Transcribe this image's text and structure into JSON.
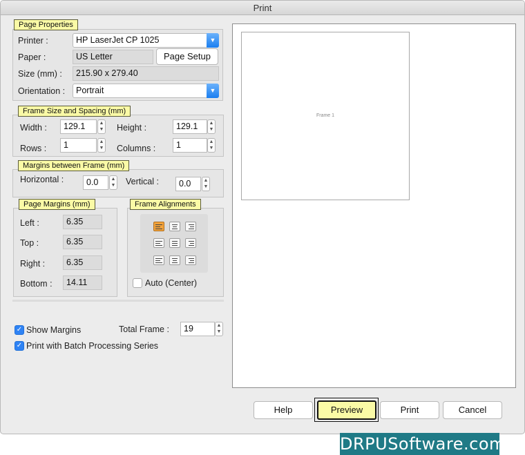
{
  "window": {
    "title": "Print"
  },
  "page_properties": {
    "legend": "Page Properties",
    "printer_label": "Printer :",
    "printer_value": "HP LaserJet CP 1025",
    "paper_label": "Paper :",
    "paper_value": "US Letter",
    "page_setup_button": "Page Setup",
    "size_label": "Size (mm) :",
    "size_value": "215.90 x 279.40",
    "orientation_label": "Orientation :",
    "orientation_value": "Portrait"
  },
  "frame_size": {
    "legend": "Frame Size and Spacing (mm)",
    "width_label": "Width :",
    "width_value": "129.1",
    "height_label": "Height :",
    "height_value": "129.1",
    "rows_label": "Rows :",
    "rows_value": "1",
    "columns_label": "Columns :",
    "columns_value": "1"
  },
  "margins_between": {
    "legend": "Margins between Frame (mm)",
    "horizontal_label": "Horizontal :",
    "horizontal_value": "0.0",
    "vertical_label": "Vertical :",
    "vertical_value": "0.0"
  },
  "page_margins": {
    "legend": "Page Margins (mm)",
    "left_label": "Left :",
    "left_value": "6.35",
    "top_label": "Top :",
    "top_value": "6.35",
    "right_label": "Right :",
    "right_value": "6.35",
    "bottom_label": "Bottom :",
    "bottom_value": "14.11"
  },
  "frame_alignments": {
    "legend": "Frame Alignments",
    "selected": "top-left",
    "auto_center_label": "Auto (Center)",
    "auto_center_checked": false
  },
  "options": {
    "show_margins_label": "Show Margins",
    "show_margins_checked": true,
    "batch_label": "Print with Batch Processing Series",
    "batch_checked": true,
    "total_frame_label": "Total Frame :",
    "total_frame_value": "19"
  },
  "preview": {
    "frame_label": "Frame 1"
  },
  "buttons": {
    "help": "Help",
    "preview": "Preview",
    "print": "Print",
    "cancel": "Cancel"
  },
  "watermark": "DRPUSoftware.com",
  "colors": {
    "accent_blue": "#2f83f4",
    "legend_yellow": "#fafaa6",
    "preview_button": "#fafaa6",
    "watermark_bg": "#1f7a86",
    "align_active": "#f2a23a"
  }
}
